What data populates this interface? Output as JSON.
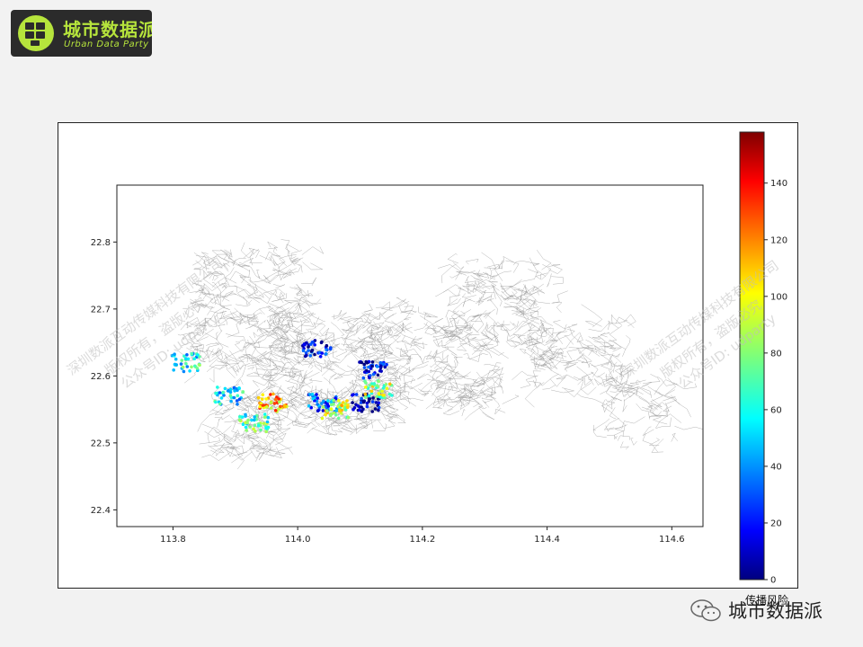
{
  "logo": {
    "title": "城市数据派",
    "subtitle": "Urban Data Party",
    "colors": {
      "background": "#2b2b2b",
      "accent": "#b6e43c"
    }
  },
  "watermarks": [
    "深圳数派互动传媒科技有限公司",
    "版权所有，盗版必究",
    "公众号ID: udparty",
    "深圳数派互动传媒科技有限公司",
    "版权所有，盗版必究",
    "公众号ID: udparty"
  ],
  "credit": {
    "icon": "wechat-icon",
    "text": "城市数据派"
  },
  "chart_data": {
    "type": "scatter",
    "xticks": [
      "113.8",
      "114.0",
      "114.2",
      "114.4",
      "114.6"
    ],
    "yticks": [
      "22.8",
      "22.7",
      "22.6",
      "22.5",
      "22.4"
    ],
    "xlim": [
      113.71,
      114.65
    ],
    "ylim": [
      22.375,
      22.885
    ],
    "colorbar": {
      "label": "传播风险",
      "ticks": [
        "0",
        "20",
        "40",
        "60",
        "80",
        "100",
        "120",
        "140"
      ],
      "range": [
        0,
        158
      ],
      "colormap": "jet"
    },
    "grid": false,
    "background": "road network of Shenzhen (grey lines)",
    "clusters": [
      {
        "lon": 113.82,
        "lat": 22.62,
        "value": 60
      },
      {
        "lon": 113.89,
        "lat": 22.57,
        "value": 55
      },
      {
        "lon": 113.93,
        "lat": 22.53,
        "value": 70
      },
      {
        "lon": 114.03,
        "lat": 22.64,
        "value": 20
      },
      {
        "lon": 114.04,
        "lat": 22.56,
        "value": 35
      },
      {
        "lon": 114.06,
        "lat": 22.55,
        "value": 90
      },
      {
        "lon": 114.11,
        "lat": 22.56,
        "value": 10
      },
      {
        "lon": 114.12,
        "lat": 22.61,
        "value": 15
      },
      {
        "lon": 114.13,
        "lat": 22.58,
        "value": 85
      },
      {
        "lon": 113.96,
        "lat": 22.56,
        "value": 110
      }
    ]
  }
}
